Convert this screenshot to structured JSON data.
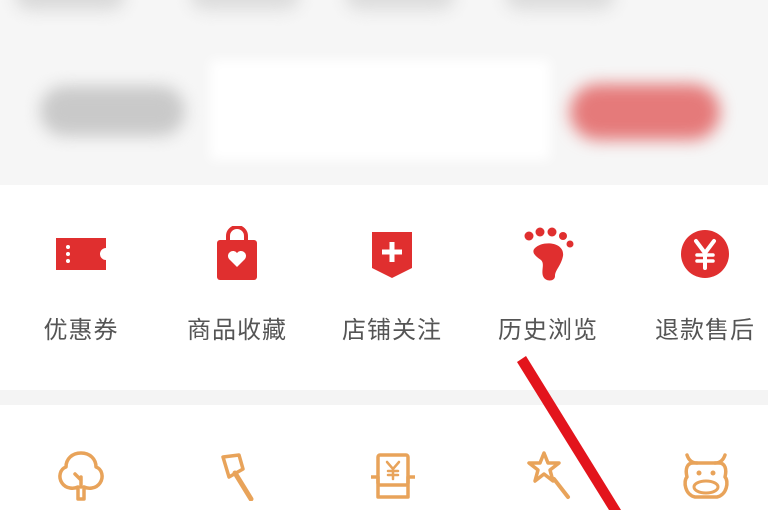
{
  "colors": {
    "accent": "#e02f2f",
    "outline_icon": "#e8a35a",
    "label": "#555555",
    "arrow": "#e3141c"
  },
  "shortcuts": [
    {
      "label": "优惠券",
      "icon": "ticket-icon"
    },
    {
      "label": "商品收藏",
      "icon": "shopping-bag-heart-icon"
    },
    {
      "label": "店铺关注",
      "icon": "shop-plus-icon"
    },
    {
      "label": "历史浏览",
      "icon": "footprint-icon"
    },
    {
      "label": "退款售后",
      "icon": "yen-circle-icon"
    }
  ],
  "services": [
    {
      "icon": "tree-icon"
    },
    {
      "icon": "axe-icon"
    },
    {
      "icon": "yen-box-icon"
    },
    {
      "icon": "star-wand-icon"
    },
    {
      "icon": "cow-face-icon"
    }
  ]
}
